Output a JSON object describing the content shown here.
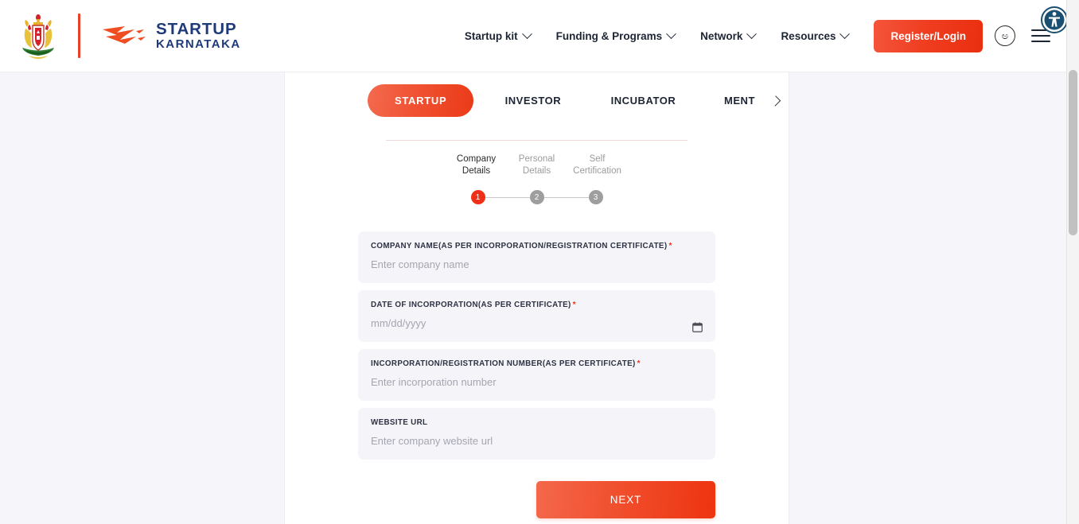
{
  "header": {
    "emblem_alt": "karnataka-state-emblem",
    "logo": {
      "line1": "STARTUP",
      "line2": "KARNATAKA"
    },
    "nav_items": [
      {
        "label": "Startup kit",
        "has_caret": true
      },
      {
        "label": "Funding & Programs",
        "has_caret": true
      },
      {
        "label": "Network",
        "has_caret": true
      },
      {
        "label": "Resources",
        "has_caret": true
      }
    ],
    "register_label": "Register/Login",
    "language_toggle": "ಅ",
    "menu_icon": "hamburger-icon",
    "accessibility_icon": "accessibility-icon"
  },
  "tabs": [
    {
      "label": "STARTUP",
      "active": true
    },
    {
      "label": "INVESTOR",
      "active": false
    },
    {
      "label": "INCUBATOR",
      "active": false
    },
    {
      "label": "MENT",
      "active": false
    }
  ],
  "tabs_next_icon": "chevron-right-icon",
  "stepper": {
    "steps": [
      {
        "label_line1": "Company",
        "label_line2": "Details",
        "number": "1",
        "active": true
      },
      {
        "label_line1": "Personal",
        "label_line2": "Details",
        "number": "2",
        "active": false
      },
      {
        "label_line1": "Self",
        "label_line2": "Certification",
        "number": "3",
        "active": false
      }
    ]
  },
  "form": {
    "fields": [
      {
        "label": "COMPANY NAME(AS PER INCORPORATION/REGISTRATION CERTIFICATE)",
        "required": true,
        "placeholder": "Enter company name",
        "value": "",
        "type": "text"
      },
      {
        "label": "DATE OF INCORPORATION(AS PER CERTIFICATE)",
        "required": true,
        "placeholder": "mm/dd/yyyy",
        "value": "",
        "type": "date"
      },
      {
        "label": "INCORPORATION/REGISTRATION NUMBER(AS PER CERTIFICATE)",
        "required": true,
        "placeholder": "Enter incorporation number",
        "value": "",
        "type": "text"
      },
      {
        "label": "WEBSITE URL",
        "required": false,
        "placeholder": "Enter company website url",
        "value": "",
        "type": "text"
      }
    ],
    "submit_label": "NEXT"
  },
  "colors": {
    "accent_red": "#ef3019",
    "brand_navy": "#1f3a79",
    "panel_bg": "#f6f6fa",
    "field_bg": "#f5f5f9"
  }
}
